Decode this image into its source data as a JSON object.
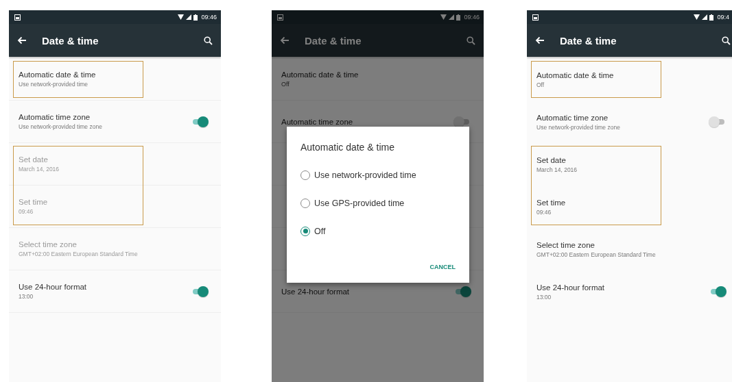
{
  "phones": [
    {
      "status_time": "09:46",
      "dimmed": false,
      "toolbar": {
        "title": "Date & time"
      },
      "rows": [
        {
          "kind": "text",
          "title": "Automatic date & time",
          "summary": "Use network-provided time",
          "disabled": false,
          "highlighted": true
        },
        {
          "kind": "toggle",
          "title": "Automatic time zone",
          "summary": "Use network-provided time zone",
          "on": true,
          "disabled": false,
          "highlighted": false
        },
        {
          "kind": "text",
          "title": "Set date",
          "summary": "March 14, 2016",
          "disabled": true,
          "highlighted": true
        },
        {
          "kind": "text",
          "title": "Set time",
          "summary": "09:46",
          "disabled": true,
          "highlighted": true
        },
        {
          "kind": "text",
          "title": "Select time zone",
          "summary": "GMT+02:00 Eastern European Standard Time",
          "disabled": true,
          "highlighted": false
        },
        {
          "kind": "toggle",
          "title": "Use 24-hour format",
          "summary": "13:00",
          "on": true,
          "disabled": false,
          "highlighted": false
        }
      ]
    },
    {
      "status_time": "09:46",
      "dimmed": true,
      "toolbar": {
        "title": "Date & time"
      },
      "rows": [
        {
          "kind": "text",
          "title": "Automatic date & time",
          "summary": "Off",
          "disabled": false,
          "highlighted": false
        },
        {
          "kind": "toggle",
          "title": "Automatic time zone",
          "on": false,
          "disabled": false,
          "highlighted": false
        },
        {
          "kind": "covered"
        },
        {
          "kind": "covered"
        },
        {
          "kind": "covered"
        },
        {
          "kind": "toggle",
          "title": "Use 24-hour format",
          "on": true,
          "disabled": false,
          "highlighted": false
        }
      ],
      "dialog": {
        "title": "Automatic date & time",
        "options": [
          {
            "label": "Use network-provided time",
            "selected": false
          },
          {
            "label": "Use GPS-provided time",
            "selected": false
          },
          {
            "label": "Off",
            "selected": true
          }
        ],
        "button": "CANCEL"
      }
    },
    {
      "status_time": "09:4",
      "dimmed": false,
      "toolbar": {
        "title": "Date & time"
      },
      "rows": [
        {
          "kind": "text",
          "title": "Automatic date & time",
          "summary": "Off",
          "disabled": false,
          "highlighted": true
        },
        {
          "kind": "toggle",
          "title": "Automatic time zone",
          "summary": "Use network-provided time zone",
          "on": false,
          "disabled": false,
          "highlighted": false
        },
        {
          "kind": "text",
          "title": "Set date",
          "summary": "March 14, 2016",
          "disabled": false,
          "highlighted": true
        },
        {
          "kind": "text",
          "title": "Set time",
          "summary": "09:46",
          "disabled": false,
          "highlighted": true
        },
        {
          "kind": "text",
          "title": "Select time zone",
          "summary": "GMT+02:00 Eastern European Standard Time",
          "disabled": false,
          "highlighted": false
        },
        {
          "kind": "toggle",
          "title": "Use 24-hour format",
          "summary": "13:00",
          "on": true,
          "disabled": false,
          "highlighted": false
        }
      ]
    }
  ]
}
